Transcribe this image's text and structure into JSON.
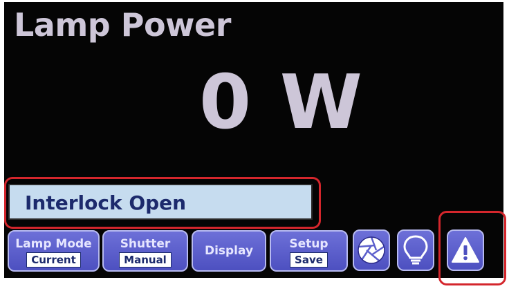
{
  "header": {
    "title": "Lamp Power"
  },
  "readout": {
    "value": "0 W"
  },
  "status": {
    "message": "Interlock Open"
  },
  "toolbar": {
    "lamp_mode": {
      "label": "Lamp Mode",
      "value": "Current"
    },
    "shutter": {
      "label": "Shutter",
      "value": "Manual"
    },
    "display": {
      "label": "Display"
    },
    "setup": {
      "label": "Setup",
      "value": "Save"
    }
  },
  "icons": {
    "shutter": "shutter-aperture-icon",
    "lamp": "lightbulb-icon",
    "warning": "warning-triangle-icon"
  },
  "colors": {
    "screen_bg": "#050505",
    "title_text": "#cdc6d8",
    "status_bg": "#c6dcef",
    "status_text": "#1c2a6c",
    "button_bg": "#5c5fcc",
    "highlight": "#d4262c"
  }
}
